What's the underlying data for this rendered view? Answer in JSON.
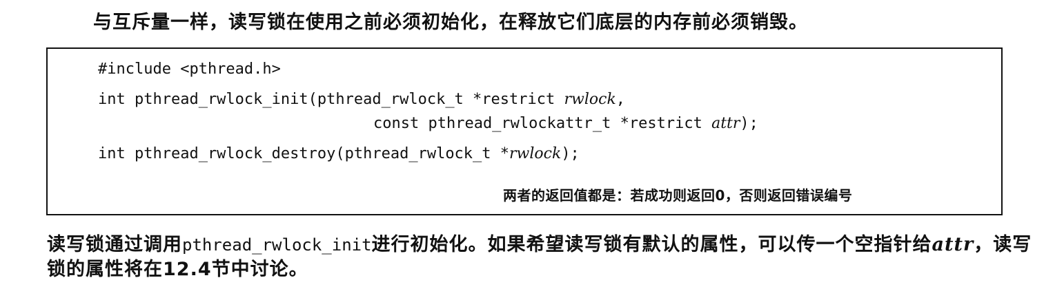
{
  "intro": "与互斥量一样，读写锁在使用之前必须初始化，在释放它们底层的内存前必须销毁。",
  "code": {
    "include": "#include <pthread.h>",
    "init_pre": "int pthread_rwlock_init(pthread_rwlock_t *restrict ",
    "init_arg": "rwlock",
    "init_post": ",",
    "init_cont_pre": "const pthread_rwlockattr_t *restrict ",
    "init_cont_arg": "attr",
    "init_cont_post": ");",
    "destroy_pre": "int pthread_rwlock_destroy(pthread_rwlock_t *",
    "destroy_arg": "rwlock",
    "destroy_post": ");",
    "return_note": "两者的返回值都是：若成功则返回0，否则返回错误编号"
  },
  "body": {
    "part1": "读写锁通过调用",
    "func": "pthread_rwlock_init",
    "part2": "进行初始化。如果希望读写锁有默认的属性，可以传一个空指针给",
    "arg": "attr",
    "part3": "，读写锁的属性将在12.4节中讨论。"
  }
}
